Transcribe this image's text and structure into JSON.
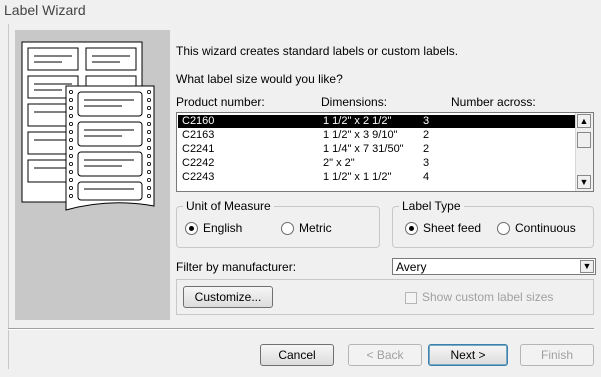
{
  "window": {
    "title": "Label Wizard"
  },
  "intro": {
    "line1": "This wizard creates standard labels or custom labels.",
    "line2": "What label size would you like?"
  },
  "list": {
    "headers": [
      "Product number:",
      "Dimensions:",
      "Number across:"
    ],
    "rows": [
      {
        "product": "C2160",
        "dimensions": "1 1/2\" x 2 1/2\"",
        "across": "3",
        "selected": true
      },
      {
        "product": "C2163",
        "dimensions": "1 1/2\" x 3 9/10\"",
        "across": "2",
        "selected": false
      },
      {
        "product": "C2241",
        "dimensions": "1 1/4\" x 7 31/50\"",
        "across": "2",
        "selected": false
      },
      {
        "product": "C2242",
        "dimensions": "2\" x 2\"",
        "across": "3",
        "selected": false
      },
      {
        "product": "C2243",
        "dimensions": "1 1/2\" x 1 1/2\"",
        "across": "4",
        "selected": false
      }
    ]
  },
  "unit_of_measure": {
    "label": "Unit of Measure",
    "options": [
      "English",
      "Metric"
    ],
    "selected": "English"
  },
  "label_type": {
    "label": "Label Type",
    "options": [
      "Sheet feed",
      "Continuous"
    ],
    "selected": "Sheet feed"
  },
  "filter": {
    "label": "Filter by manufacturer:",
    "value": "Avery"
  },
  "custom": {
    "customize_label": "Customize...",
    "show_custom_label": "Show custom label sizes",
    "show_custom_checked": false
  },
  "buttons": {
    "cancel": "Cancel",
    "back": "< Back",
    "next": "Next >",
    "finish": "Finish"
  },
  "icons": {
    "scroll_up": "scroll-up-icon",
    "scroll_down": "scroll-down-icon",
    "dropdown": "chevron-down-icon",
    "illustration": "label-sheets-illustration"
  },
  "colors": {
    "dialog_bg": "#f0f0f0",
    "illustration_panel": "#c8c8c8",
    "selection": "#000000"
  }
}
